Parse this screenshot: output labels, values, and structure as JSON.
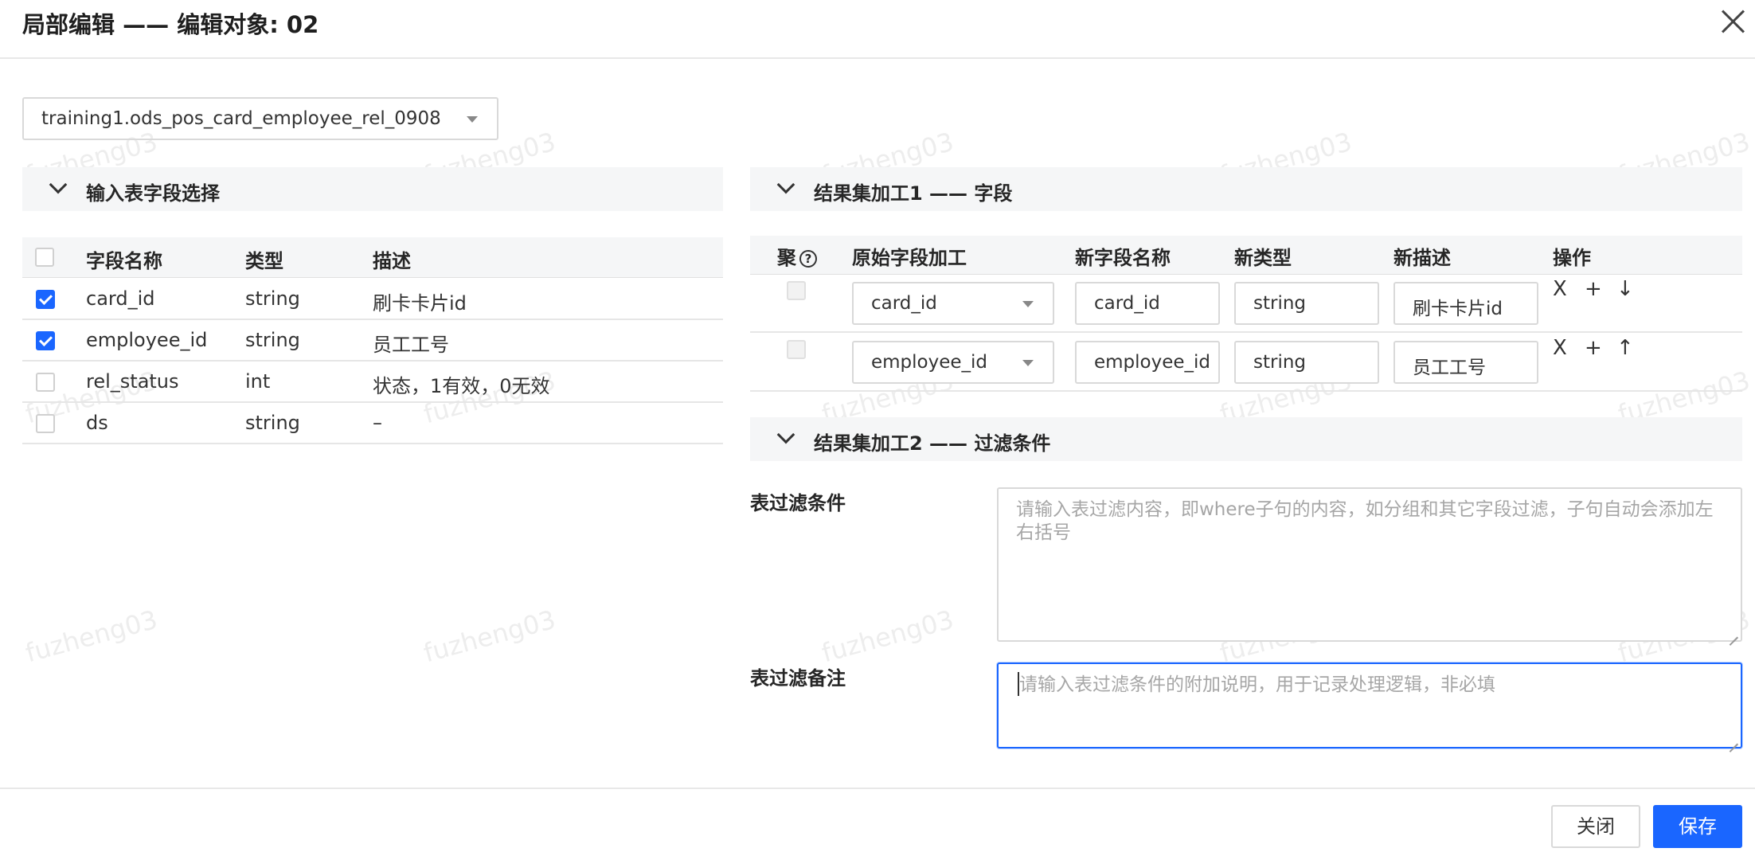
{
  "dialog": {
    "title": "局部编辑 —— 编辑对象: 02"
  },
  "table_select": {
    "value": "training1.ods_pos_card_employee_rel_0908"
  },
  "input_section": {
    "title": "输入表字段选择",
    "columns": [
      "字段名称",
      "类型",
      "描述"
    ],
    "rows": [
      {
        "checked": true,
        "name": "card_id",
        "type": "string",
        "desc": "刷卡卡片id"
      },
      {
        "checked": true,
        "name": "employee_id",
        "type": "string",
        "desc": "员工工号"
      },
      {
        "checked": false,
        "name": "rel_status",
        "type": "int",
        "desc": "状态，1有效，0无效"
      },
      {
        "checked": false,
        "name": "ds",
        "type": "string",
        "desc": "–"
      }
    ]
  },
  "result1": {
    "title": "结果集加工1 —— 字段",
    "columns": {
      "agg": "聚",
      "agg_help": "?",
      "source": "原始字段加工",
      "new_name": "新字段名称",
      "new_type": "新类型",
      "new_desc": "新描述",
      "ops": "操作"
    },
    "rows": [
      {
        "source": "card_id",
        "new_name": "card_id",
        "new_type": "string",
        "new_desc": "刷卡卡片id",
        "ops": [
          "X",
          "+",
          "↓"
        ]
      },
      {
        "source": "employee_id",
        "new_name": "employee_id",
        "new_type": "string",
        "new_desc": "员工工号",
        "ops": [
          "X",
          "+",
          "↑"
        ]
      }
    ]
  },
  "result2": {
    "title": "结果集加工2 —— 过滤条件",
    "filter_label": "表过滤条件",
    "filter_placeholder": "请输入表过滤内容，即where子句的内容，如分组和其它字段过滤，子句自动会添加左右括号",
    "note_label": "表过滤备注",
    "note_placeholder": "请输入表过滤条件的附加说明，用于记录处理逻辑，非必填"
  },
  "footer": {
    "close_label": "关闭",
    "save_label": "保存"
  },
  "watermark": "fuzheng03",
  "colors": {
    "primary": "#1a66ff",
    "section_bg": "#f5f6f7"
  }
}
